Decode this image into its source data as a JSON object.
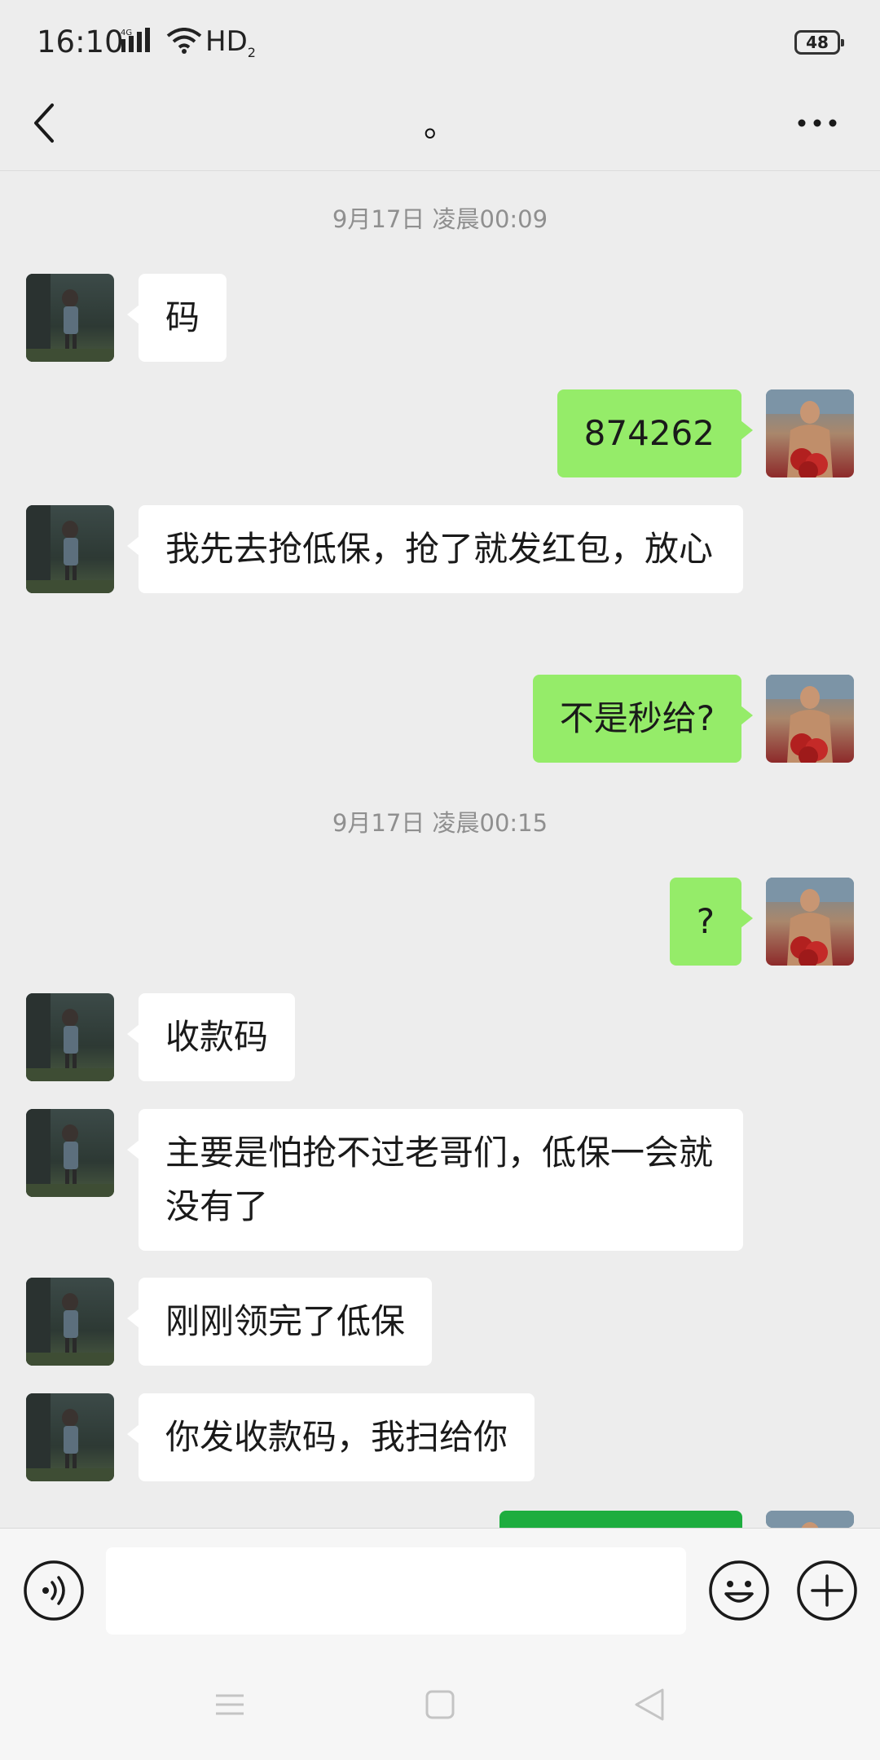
{
  "status_bar": {
    "time": "16:10",
    "network": "4G",
    "hd_label": "HD",
    "hd_sub": "2",
    "battery": "48"
  },
  "header": {
    "title": "。"
  },
  "messages": [
    {
      "type": "timestamp",
      "text": "9月17日 凌晨00:09"
    },
    {
      "type": "bubble",
      "from": "other",
      "text": "码"
    },
    {
      "type": "bubble",
      "from": "me",
      "text": "874262"
    },
    {
      "type": "bubble",
      "from": "other",
      "text": "我先去抢低保，抢了就发红包，放心"
    },
    {
      "type": "bubble",
      "from": "me",
      "text": "不是秒给?"
    },
    {
      "type": "timestamp",
      "text": "9月17日 凌晨00:15"
    },
    {
      "type": "bubble",
      "from": "me",
      "text": "?"
    },
    {
      "type": "bubble",
      "from": "other",
      "text": "收款码"
    },
    {
      "type": "bubble",
      "from": "other",
      "text": "主要是怕抢不过老哥们，低保一会就没有了"
    },
    {
      "type": "bubble",
      "from": "other",
      "text": "刚刚领完了低保"
    },
    {
      "type": "bubble",
      "from": "other",
      "text": "你发收款码，我扫给你"
    }
  ],
  "input_bar": {
    "placeholder": "",
    "value": ""
  },
  "colors": {
    "background": "#ededed",
    "bubble_me": "#95ec69",
    "bubble_other": "#ffffff",
    "partial_bubble": "#1ead3f"
  },
  "icons": {
    "back": "chevron-left-icon",
    "more": "more-dots-icon",
    "voice": "voice-icon",
    "emoji": "emoji-icon",
    "plus": "plus-icon"
  }
}
